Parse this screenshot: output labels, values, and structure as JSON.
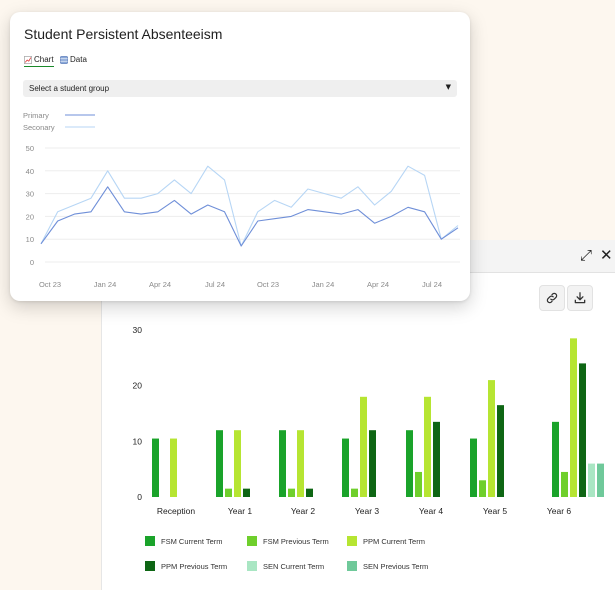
{
  "card": {
    "title": "Student Persistent Absenteeism",
    "tabs": [
      {
        "label": "Chart",
        "icon": "chart-icon",
        "active": true
      },
      {
        "label": "Data",
        "icon": "table-icon",
        "active": false
      }
    ],
    "select_placeholder": "Select a student group"
  },
  "back_panel": {
    "header_icons": [
      "expand-icon",
      "close-icon"
    ],
    "tools": [
      "link-icon",
      "download-icon"
    ]
  },
  "chart_data": [
    {
      "type": "line",
      "title": "",
      "x": [
        "Oct 23",
        "",
        "Jan 24",
        "",
        "Apr 24",
        "",
        "Jul 24",
        "",
        "Oct 23",
        "",
        "Jan 24",
        "",
        "Apr 24",
        "",
        "Jul 24",
        ""
      ],
      "x_tick_labels": [
        "Oct 23",
        "Jan 24",
        "Apr 24",
        "Jul 24",
        "Oct 23",
        "Jan 24",
        "Apr 24",
        "Jul 24"
      ],
      "ylim": [
        0,
        50
      ],
      "y_ticks": [
        0,
        10,
        20,
        30,
        40,
        50
      ],
      "legend_placement": "top-left",
      "grid": true,
      "series": [
        {
          "name": "Primary",
          "color": "#6f8fd8",
          "values": [
            8,
            18,
            21,
            22,
            33,
            22,
            21,
            22,
            27,
            21,
            25,
            22,
            7,
            18,
            19,
            20,
            23,
            22,
            21,
            23,
            17,
            20,
            24,
            22,
            10,
            15
          ]
        },
        {
          "name": "Seconary",
          "color": "#b7d6f5",
          "values": [
            8,
            22,
            25,
            28,
            40,
            28,
            28,
            30,
            36,
            30,
            42,
            36,
            7,
            22,
            27,
            24,
            32,
            30,
            28,
            33,
            25,
            31,
            42,
            38,
            10,
            16
          ]
        }
      ]
    },
    {
      "type": "bar",
      "categories": [
        "Reception",
        "Year 1",
        "Year 2",
        "Year 3",
        "Year 4",
        "Year 5",
        "Year 6"
      ],
      "ylim": [
        0,
        30
      ],
      "y_ticks": [
        0,
        10,
        20,
        30
      ],
      "legend_placement": "bottom",
      "grid": false,
      "series": [
        {
          "name": "FSM Current Term",
          "color": "#1aa32a",
          "values": [
            10.5,
            12,
            12,
            10.5,
            12,
            10.5,
            13.5
          ]
        },
        {
          "name": "FSM Previous Term",
          "color": "#6fcf2c",
          "values": [
            0,
            1.5,
            1.5,
            1.5,
            4.5,
            3,
            4.5
          ]
        },
        {
          "name": "PPM Current Term",
          "color": "#b6e532",
          "values": [
            10.5,
            12,
            12,
            18,
            18,
            21,
            28.5
          ]
        },
        {
          "name": "PPM Previous Term",
          "color": "#0e6614",
          "values": [
            0,
            1.5,
            1.5,
            12,
            13.5,
            16.5,
            24
          ]
        },
        {
          "name": "SEN Current Term",
          "color": "#a9e6c3",
          "values": [
            0,
            0,
            0,
            0,
            0,
            0,
            6
          ]
        },
        {
          "name": "SEN Previous Term",
          "color": "#6fc99a",
          "values": [
            0,
            0,
            0,
            0,
            0,
            0,
            6
          ]
        }
      ]
    }
  ]
}
